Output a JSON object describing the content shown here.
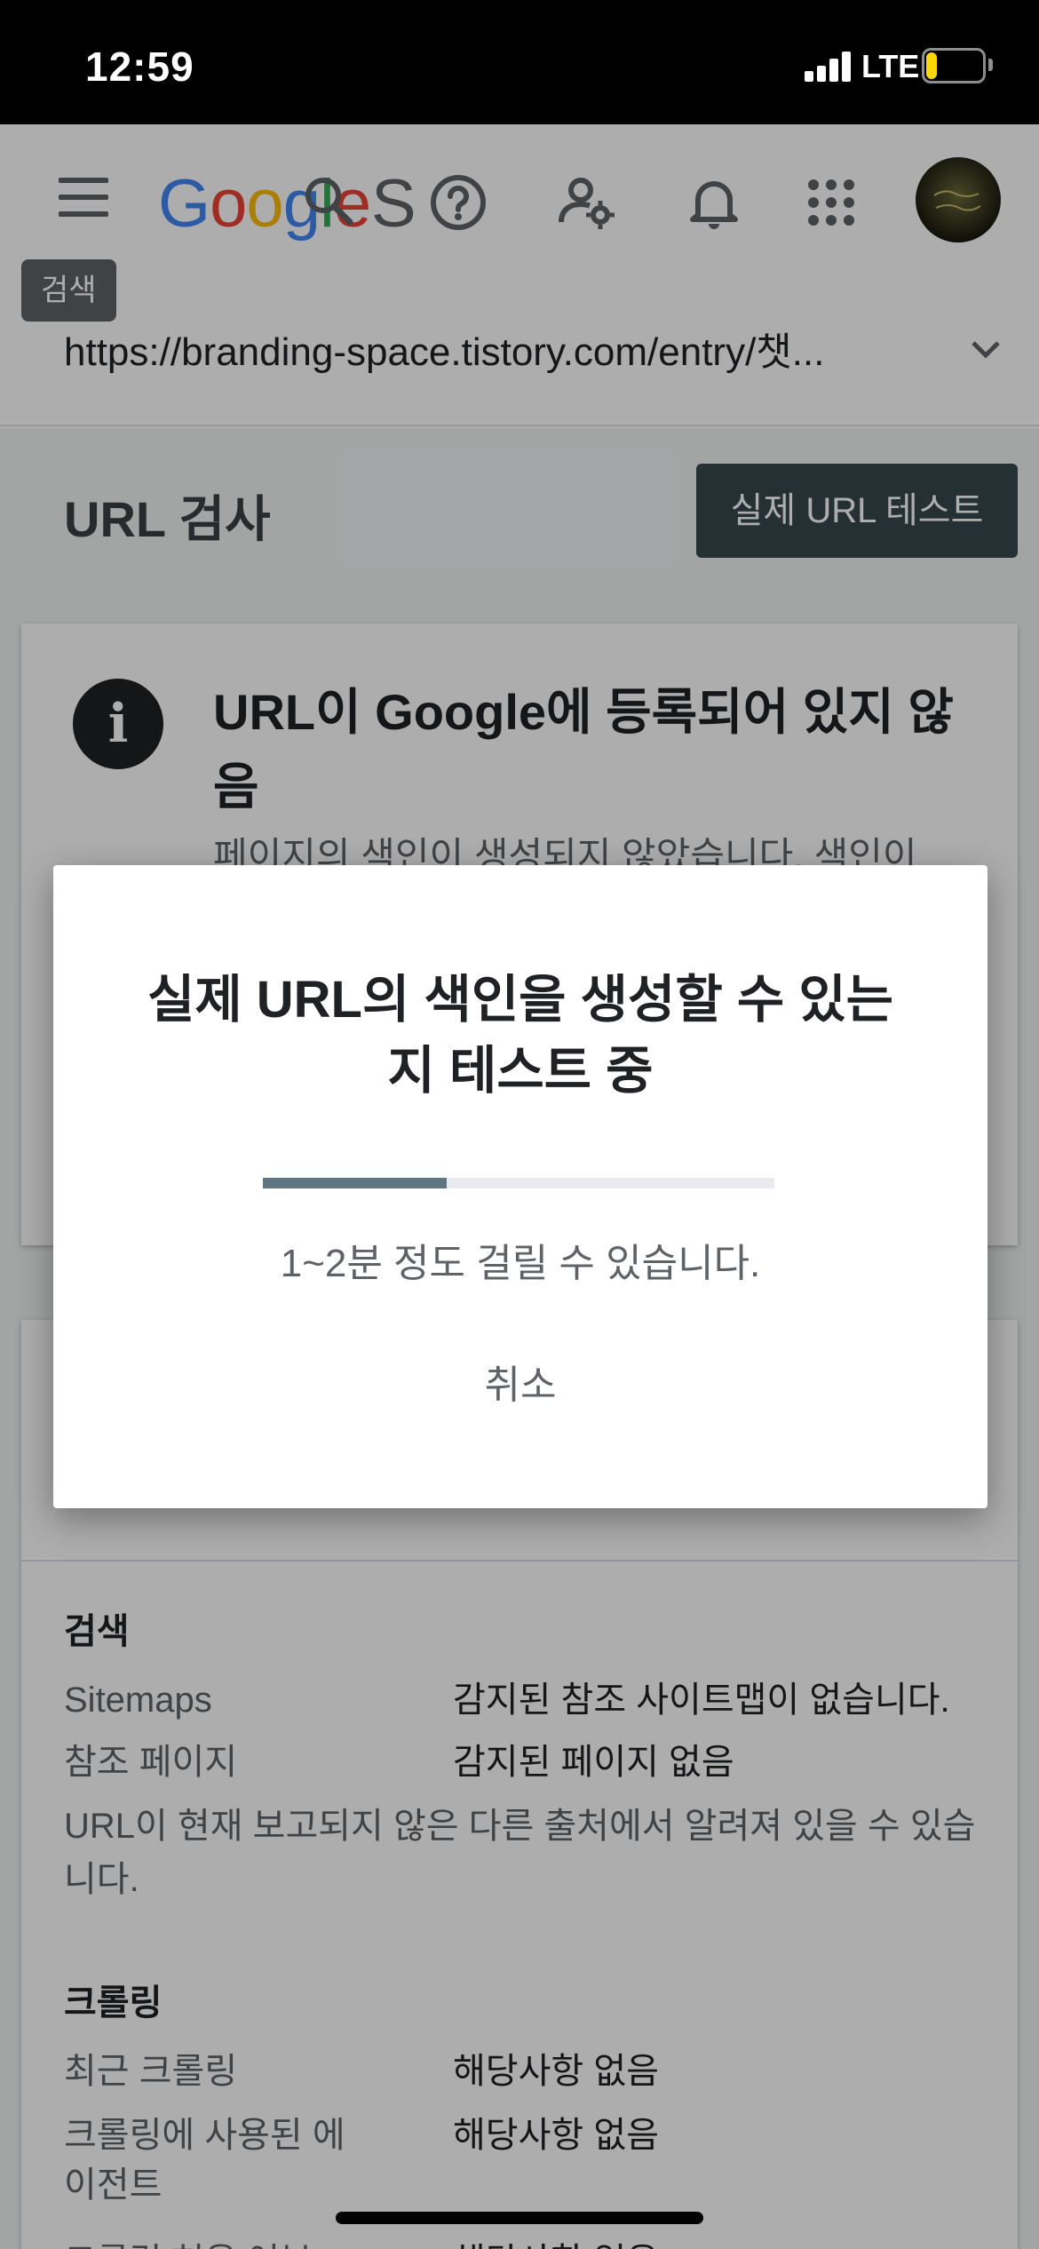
{
  "status_bar": {
    "time": "12:59",
    "network": "LTE",
    "battery_level": "20",
    "battery_fraction": 0.2
  },
  "header": {
    "logo_letters": [
      "G",
      "o",
      "o",
      "g",
      "l",
      "e"
    ],
    "logo_trail": "S",
    "tooltip": "검색",
    "url": "https://branding-space.tistory.com/entry/챗..."
  },
  "page": {
    "title": "URL 검사",
    "live_test_button": "실제 URL 테스트",
    "status_card": {
      "title": "URL이 Google에 등록되어 있지 않음",
      "description": "페이지의 색인이 생성되지 않았습니다. 색인이"
    },
    "discovery": {
      "heading": "검색",
      "rows": [
        {
          "label": "Sitemaps",
          "value": "감지된 참조 사이트맵이 없습니다."
        },
        {
          "label": "참조 페이지",
          "value": "감지된 페이지 없음"
        }
      ],
      "note": "URL이 현재 보고되지 않은 다른 출처에서 알려져 있을 수 있습니다."
    },
    "crawl": {
      "heading": "크롤링",
      "rows": [
        {
          "label": "최근 크롤링",
          "value": "해당사항 없음"
        },
        {
          "label": "크롤링에 사용된 에이전트",
          "value": "해당사항 없음"
        },
        {
          "label": "크롤링 허용 여부",
          "value": "해당사항 없음"
        }
      ]
    }
  },
  "dialog": {
    "title": "실제 URL의 색인을 생성할 수 있는지 테스트 중",
    "progress": 0.36,
    "subtitle": "1~2분 정도 걸릴 수 있습니다.",
    "cancel_label": "취소"
  },
  "colors": {
    "google_blue": "#4285f4",
    "google_red": "#ea4335",
    "google_yellow": "#fbbc05",
    "google_green": "#34a853",
    "progress_fill": "#5f7682",
    "button_dark": "#37474f"
  }
}
